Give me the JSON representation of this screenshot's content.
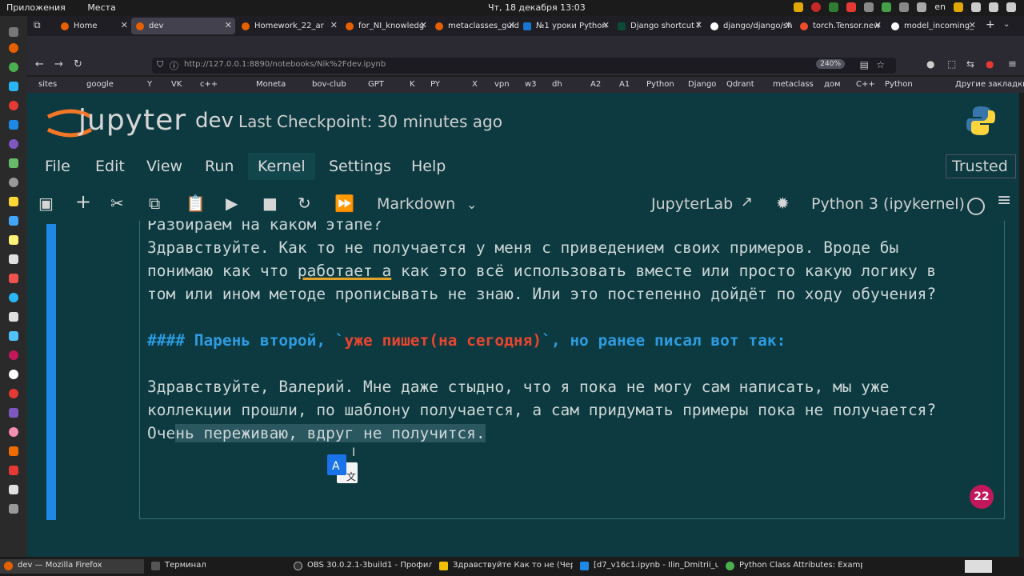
{
  "topbar": {
    "apps": "Приложения",
    "places": "Места",
    "datetime": "Чт, 18 декабря  13:03",
    "lang": "en"
  },
  "tabs": [
    {
      "label": "Home",
      "color": "#e66000"
    },
    {
      "label": "dev",
      "color": "#e66000"
    },
    {
      "label": "Homework_22_ar",
      "color": "#e66000"
    },
    {
      "label": "for_NI_knowledg",
      "color": "#e66000"
    },
    {
      "label": "metaclasses_guid",
      "color": "#e66000"
    },
    {
      "label": "№1 уроки Python",
      "color": "#1976d2"
    },
    {
      "label": "Django shortcut f",
      "color": "#0c4b33"
    },
    {
      "label": "django/django/sh",
      "color": "#ffffff"
    },
    {
      "label": "torch.Tensor.new",
      "color": "#ee4c2c"
    },
    {
      "label": "model_incoming_",
      "color": "#ffffff"
    }
  ],
  "url": {
    "text": "http://127.0.0.1:8890/notebooks/Nik%2Fdev.ipynb",
    "zoom": "240%"
  },
  "bookmarks": [
    "sites",
    "google",
    "Y",
    "VK",
    "c++",
    "Moneta",
    "bov-club",
    "GPT",
    "K",
    "PY",
    "X",
    "vpn",
    "w3",
    "dh",
    "A2",
    "A1",
    "Python",
    "Django",
    "Qdrant",
    "metaclass",
    "дом",
    "C++",
    "Python",
    "Другие закладки"
  ],
  "jupyter": {
    "brand": "jupyter",
    "notebook_name": "dev",
    "checkpoint": "Last Checkpoint: 30 minutes ago",
    "menu": [
      "File",
      "Edit",
      "View",
      "Run",
      "Kernel",
      "Settings",
      "Help"
    ],
    "trusted": "Trusted",
    "cell_type": "Markdown",
    "jupyterlab": "JupyterLab",
    "kernel": "Python 3 (ipykernel)"
  },
  "cell": {
    "line0": "Разбираем на каком этапе?",
    "line1": "Здравствуйте. Как то не получается у меня с приведением своих примеров. Вроде бы",
    "line2a": "понимаю как что ",
    "line2b": "работает а",
    "line2c": " как это всё использовать вместе или просто какую логику в",
    "line3": "том или ином методе прописывать не знаю. Или это постепенно дойдёт по ходу обучения?",
    "h_prefix": "#### Парень второй, `",
    "h_code": "уже пишет(на сегодня)",
    "h_suffix": "`, но ранее писал вот так:",
    "line5": "Здравствуйте, Валерий. Мне даже стыдно, что я пока не могу сам написать, мы уже",
    "line6": "коллекции прошли, по шаблону получается, а сам придумать примеры пока не получается?",
    "line7a": "Оче",
    "line7b": "нь переживаю, вдруг не получится."
  },
  "badge": "22",
  "taskbar": [
    {
      "label": "dev — Mozilla Firefox",
      "color": "#e66000"
    },
    {
      "label": "Терминал",
      "color": "#555555"
    },
    {
      "label": "OBS 30.0.2.1-3build1 - Профиль: Б...",
      "color": "#333333"
    },
    {
      "label": "Здравствуйте Как то не (Чернови...",
      "color": "#f2c200"
    },
    {
      "label": "[d7_v16c1.ipynb - Ilin_Dmitrii_udv ...",
      "color": "#1e88e5"
    },
    {
      "label": "Python Class Attributes: Examples ...",
      "color": "#4caf50"
    }
  ]
}
